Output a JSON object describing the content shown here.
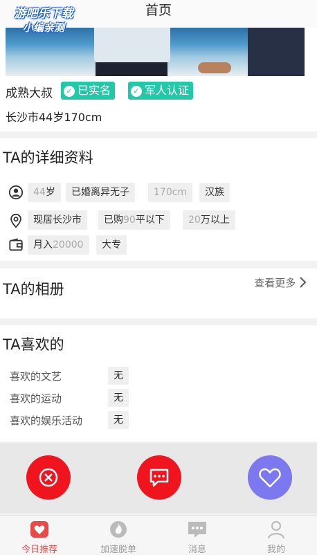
{
  "watermark": {
    "line1": "游吧乐下载",
    "line2": "小编亲测"
  },
  "header": {
    "title": "首页"
  },
  "profile": {
    "name": "成熟大叔",
    "badges": [
      "已实名",
      "军人认证"
    ],
    "location_line": "长沙市44岁170cm"
  },
  "details": {
    "title": "TA的详细资料",
    "row1": [
      {
        "num": "44",
        "unit": "岁"
      },
      {
        "text": "已婚离异无子"
      },
      {
        "num": "170cm"
      },
      {
        "text": "汉族"
      }
    ],
    "row2": [
      {
        "text": "现居长沙市"
      },
      {
        "pre": "已购",
        "num": "90",
        "post": "平以下"
      },
      {
        "num": "20",
        "post": "万以上"
      }
    ],
    "row3": [
      {
        "pre": "月入",
        "num": "20000"
      },
      {
        "text": "大专"
      }
    ]
  },
  "album": {
    "title": "TA的相册",
    "more": "查看更多"
  },
  "likes": {
    "title": "TA喜欢的",
    "items": [
      {
        "label": "喜欢的文艺",
        "value": "无"
      },
      {
        "label": "喜欢的运动",
        "value": "无"
      },
      {
        "label": "喜欢的娱乐活动",
        "value": "无"
      }
    ]
  },
  "colors": {
    "accent_green": "#22c9a8",
    "red": "#f0141e",
    "purple": "#7b78f0",
    "tab_active": "#e84a4a"
  },
  "tabs": [
    {
      "label": "今日推荐",
      "icon": "heart-icon",
      "active": true
    },
    {
      "label": "加速脱单",
      "icon": "flame-icon"
    },
    {
      "label": "消息",
      "icon": "message-icon"
    },
    {
      "label": "我的",
      "icon": "person-icon"
    }
  ]
}
